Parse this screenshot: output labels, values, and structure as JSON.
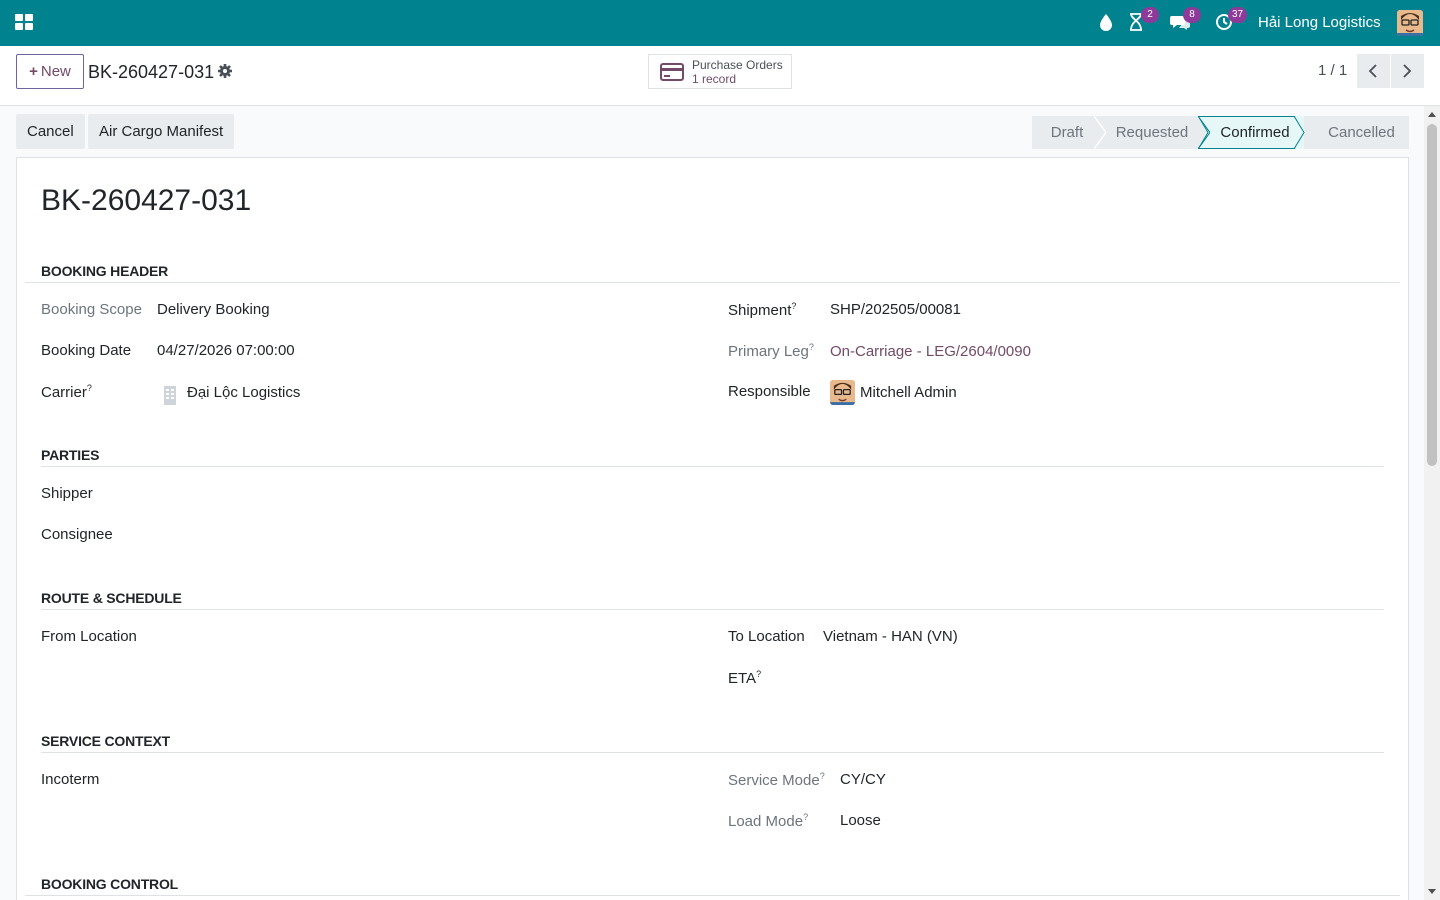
{
  "colors": {
    "navbar": "#00838f",
    "brand": "#714b67",
    "badge": "#8e3a9a",
    "active_stage": "#e6f7f8"
  },
  "navbar": {
    "badges": {
      "activities": "2",
      "messages": "8",
      "updates": "37"
    },
    "company": "Hải Long Logistics"
  },
  "control": {
    "new_label": "New",
    "breadcrumb": "BK-260427-031",
    "smart_button": {
      "title": "Purchase Orders",
      "subtitle": "1 record"
    },
    "pager": "1 / 1"
  },
  "actions": {
    "cancel": "Cancel",
    "manifest": "Air Cargo Manifest"
  },
  "stages": [
    {
      "label": "Draft",
      "active": false
    },
    {
      "label": "Requested",
      "active": false
    },
    {
      "label": "Confirmed",
      "active": true
    },
    {
      "label": "Cancelled",
      "active": false
    }
  ],
  "record": {
    "title": "BK-260427-031",
    "sections": {
      "header": "BOOKING HEADER",
      "parties": "PARTIES",
      "route": "ROUTE & SCHEDULE",
      "service": "SERVICE CONTEXT",
      "control": "BOOKING CONTROL"
    },
    "fields": {
      "booking_scope": {
        "label": "Booking Scope",
        "value": "Delivery Booking"
      },
      "booking_date": {
        "label": "Booking Date",
        "value": "04/27/2026 07:00:00"
      },
      "carrier": {
        "label": "Carrier",
        "value": "Đại Lộc Logistics"
      },
      "shipment": {
        "label": "Shipment",
        "value": "SHP/202505/00081"
      },
      "primary_leg": {
        "label": "Primary Leg",
        "value": "On-Carriage - LEG/2604/0090"
      },
      "responsible": {
        "label": "Responsible",
        "value": "Mitchell Admin"
      },
      "shipper": {
        "label": "Shipper"
      },
      "consignee": {
        "label": "Consignee"
      },
      "from_location": {
        "label": "From Location"
      },
      "to_location": {
        "label": "To Location",
        "value": "Vietnam - HAN (VN)"
      },
      "eta": {
        "label": "ETA"
      },
      "incoterm": {
        "label": "Incoterm"
      },
      "service_mode": {
        "label": "Service Mode",
        "value": "CY/CY"
      },
      "load_mode": {
        "label": "Load Mode",
        "value": "Loose"
      }
    },
    "help_mark": "?"
  }
}
